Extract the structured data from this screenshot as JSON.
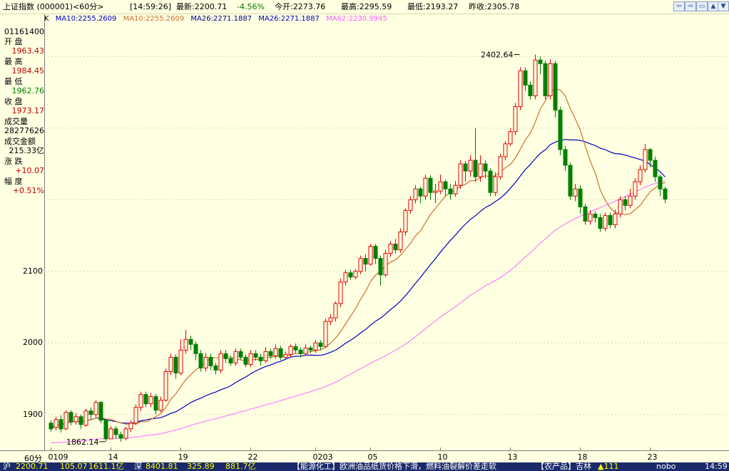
{
  "title_bar": {
    "index_name": "上证指数 (000001)<60分>",
    "time": "[14:59:26]",
    "latest": "最新:2200.71",
    "change_pct": "-4.56%",
    "open": "今开:2273.76",
    "high": "最高:2295.59",
    "low": "最低:2193.27",
    "prev_close": "昨收:2305.78",
    "buttons": [
      "⇦",
      "⇨",
      "▭",
      "▲",
      "▼"
    ]
  },
  "ma_bar": {
    "k_label": "K",
    "ma10_a": "MA10:2255.2609",
    "ma10_b": "MA10:2255.2609",
    "ma26_a": "MA26:2271.1887",
    "ma26_b": "MA26:2271.1887",
    "ma62": "MA62:2230.9945"
  },
  "left_panel": {
    "code": "01161400",
    "rows": [
      {
        "label": "开  盘",
        "value": "1963.43",
        "color": "#c00000"
      },
      {
        "label": "最  高",
        "value": "1984.45",
        "color": "#c00000"
      },
      {
        "label": "最  低",
        "value": "1962.76",
        "color": "#008000"
      },
      {
        "label": "收  盘",
        "value": "1973.17",
        "color": "#c00000"
      },
      {
        "label": "成交量",
        "value": "28277626",
        "color": "#000000"
      },
      {
        "label": "成交金额",
        "value": "215.33亿",
        "color": "#000000"
      },
      {
        "label": "涨  跌",
        "value": "+10.07",
        "color": "#c00000"
      },
      {
        "label": "幅  度",
        "value": "+0.51%",
        "color": "#c00000"
      }
    ]
  },
  "price_axis": [
    {
      "value": 1900,
      "label": "1900"
    },
    {
      "value": 2000,
      "label": "2000"
    },
    {
      "value": 2100,
      "label": "2100"
    }
  ],
  "x_axis": {
    "unit": "60分",
    "ticks": [
      {
        "label": "0109",
        "i": 0
      },
      {
        "label": "14",
        "i": 12
      },
      {
        "label": "19",
        "i": 26
      },
      {
        "label": "22",
        "i": 40
      },
      {
        "label": "0203",
        "i": 53
      },
      {
        "label": "05",
        "i": 64
      },
      {
        "label": "10",
        "i": 78
      },
      {
        "label": "13",
        "i": 92
      },
      {
        "label": "18",
        "i": 106
      },
      {
        "label": "23",
        "i": 120
      }
    ]
  },
  "ticker": {
    "items": [
      "沪",
      "2200.71",
      "105.07",
      "1611.1亿",
      "深",
      "8401.81",
      "325.89",
      "881.7亿",
      "【能源化工】欧洲油品纸货价格下滑，燃料油裂解价差走软",
      "【农产品】吉林",
      "▲111",
      "nobo",
      "14:59"
    ]
  },
  "chart_data": {
    "type": "candlestick",
    "title": "",
    "xlabel": "",
    "ylabel": "",
    "ylim": [
      1850,
      2445
    ],
    "colors": {
      "up": "#e00000",
      "down": "#008000",
      "ma10": "#d07030",
      "ma26": "#0000c0",
      "ma62": "#ff80ff"
    },
    "annotations": [
      {
        "text": "2402.64",
        "i": 94,
        "price": 2402.64
      },
      {
        "text": "1862.14",
        "i": 11,
        "price": 1862.14
      }
    ],
    "candles": [
      [
        1888,
        1880,
        1892,
        1876
      ],
      [
        1882,
        1893,
        1897,
        1878
      ],
      [
        1893,
        1880,
        1899,
        1875
      ],
      [
        1880,
        1903,
        1906,
        1878
      ],
      [
        1903,
        1890,
        1906,
        1885
      ],
      [
        1890,
        1897,
        1902,
        1886
      ],
      [
        1897,
        1886,
        1900,
        1880
      ],
      [
        1885,
        1905,
        1908,
        1883
      ],
      [
        1905,
        1900,
        1910,
        1893
      ],
      [
        1900,
        1917,
        1920,
        1896
      ],
      [
        1917,
        1892,
        1919,
        1888
      ],
      [
        1892,
        1866,
        1894,
        1862.14
      ],
      [
        1866,
        1880,
        1884,
        1866
      ],
      [
        1880,
        1872,
        1884,
        1866
      ],
      [
        1872,
        1867,
        1876,
        1862.14
      ],
      [
        1867,
        1880,
        1883,
        1864
      ],
      [
        1880,
        1888,
        1892,
        1876
      ],
      [
        1888,
        1910,
        1914,
        1885
      ],
      [
        1910,
        1928,
        1932,
        1905
      ],
      [
        1928,
        1915,
        1932,
        1910
      ],
      [
        1915,
        1925,
        1930,
        1910
      ],
      [
        1925,
        1906,
        1929,
        1900
      ],
      [
        1906,
        1920,
        1925,
        1903
      ],
      [
        1920,
        1960,
        1964,
        1918
      ],
      [
        1960,
        1980,
        1985,
        1955
      ],
      [
        1980,
        1958,
        1984,
        1950
      ],
      [
        1958,
        1990,
        2005,
        1955
      ],
      [
        1990,
        2005,
        2018,
        1985
      ],
      [
        2005,
        1998,
        2010,
        1990
      ],
      [
        1998,
        1985,
        2002,
        1976
      ],
      [
        1985,
        1965,
        1990,
        1960
      ],
      [
        1965,
        1980,
        1986,
        1960
      ],
      [
        1980,
        1968,
        1985,
        1962
      ],
      [
        1968,
        1962,
        1972,
        1956
      ],
      [
        1962,
        1985,
        1990,
        1958
      ],
      [
        1985,
        1978,
        1990,
        1972
      ],
      [
        1978,
        1972,
        1982,
        1968
      ],
      [
        1972,
        1988,
        1992,
        1968
      ],
      [
        1988,
        1980,
        1992,
        1976
      ],
      [
        1980,
        1970,
        1984,
        1966
      ],
      [
        1970,
        1985,
        1990,
        1966
      ],
      [
        1985,
        1980,
        1990,
        1975
      ],
      [
        1980,
        1975,
        1985,
        1968
      ],
      [
        1975,
        1988,
        1994,
        1972
      ],
      [
        1988,
        1982,
        1992,
        1978
      ],
      [
        1982,
        1992,
        1998,
        1978
      ],
      [
        1992,
        1980,
        1996,
        1976
      ],
      [
        1980,
        1984,
        1988,
        1978
      ],
      [
        1984,
        1995,
        1998,
        1980
      ],
      [
        1995,
        1990,
        1999,
        1985
      ],
      [
        1990,
        1985,
        1994,
        1980
      ],
      [
        1985,
        1993,
        1998,
        1982
      ],
      [
        1993,
        1990,
        1996,
        1986
      ],
      [
        1990,
        2000,
        2004,
        1986
      ],
      [
        2000,
        1995,
        2004,
        1990
      ],
      [
        1995,
        2030,
        2034,
        1993
      ],
      [
        2030,
        2035,
        2040,
        2025
      ],
      [
        2035,
        2055,
        2058,
        2030
      ],
      [
        2055,
        2085,
        2090,
        2050
      ],
      [
        2085,
        2098,
        2102,
        2080
      ],
      [
        2098,
        2092,
        2102,
        2088
      ],
      [
        2092,
        2100,
        2103,
        2089
      ],
      [
        2100,
        2118,
        2122,
        2096
      ],
      [
        2118,
        2110,
        2124,
        2100
      ],
      [
        2110,
        2135,
        2138,
        2108
      ],
      [
        2135,
        2118,
        2138,
        2110
      ],
      [
        2118,
        2095,
        2122,
        2080
      ],
      [
        2095,
        2125,
        2130,
        2092
      ],
      [
        2125,
        2138,
        2142,
        2120
      ],
      [
        2138,
        2130,
        2145,
        2125
      ],
      [
        2130,
        2155,
        2160,
        2126
      ],
      [
        2155,
        2185,
        2188,
        2150
      ],
      [
        2185,
        2200,
        2205,
        2180
      ],
      [
        2200,
        2215,
        2220,
        2195
      ],
      [
        2215,
        2205,
        2218,
        2195
      ],
      [
        2205,
        2230,
        2235,
        2200
      ],
      [
        2230,
        2210,
        2234,
        2200
      ],
      [
        2210,
        2212,
        2222,
        2195
      ],
      [
        2212,
        2225,
        2235,
        2208
      ],
      [
        2225,
        2215,
        2228,
        2205
      ],
      [
        2215,
        2208,
        2222,
        2200
      ],
      [
        2208,
        2220,
        2226,
        2204
      ],
      [
        2220,
        2250,
        2255,
        2215
      ],
      [
        2250,
        2240,
        2254,
        2225
      ],
      [
        2240,
        2255,
        2262,
        2232
      ],
      [
        2255,
        2232,
        2300,
        2225
      ],
      [
        2232,
        2250,
        2262,
        2225
      ],
      [
        2250,
        2240,
        2255,
        2230
      ],
      [
        2240,
        2210,
        2244,
        2205
      ],
      [
        2210,
        2232,
        2238,
        2205
      ],
      [
        2232,
        2260,
        2264,
        2228
      ],
      [
        2260,
        2278,
        2282,
        2255
      ],
      [
        2278,
        2295,
        2300,
        2275
      ],
      [
        2295,
        2330,
        2335,
        2290
      ],
      [
        2330,
        2380,
        2385,
        2325
      ],
      [
        2380,
        2360,
        2385,
        2352
      ],
      [
        2360,
        2345,
        2365,
        2340
      ],
      [
        2345,
        2395,
        2402.64,
        2340
      ],
      [
        2395,
        2390,
        2400,
        2375
      ],
      [
        2390,
        2345,
        2394,
        2340
      ],
      [
        2345,
        2390,
        2396,
        2340
      ],
      [
        2390,
        2325,
        2394,
        2315
      ],
      [
        2325,
        2270,
        2330,
        2262
      ],
      [
        2270,
        2248,
        2275,
        2240
      ],
      [
        2248,
        2205,
        2252,
        2200
      ],
      [
        2205,
        2215,
        2222,
        2198
      ],
      [
        2215,
        2190,
        2220,
        2180
      ],
      [
        2190,
        2170,
        2194,
        2165
      ],
      [
        2170,
        2180,
        2185,
        2165
      ],
      [
        2180,
        2175,
        2184,
        2168
      ],
      [
        2175,
        2160,
        2180,
        2155
      ],
      [
        2160,
        2178,
        2182,
        2156
      ],
      [
        2178,
        2165,
        2182,
        2160
      ],
      [
        2165,
        2180,
        2186,
        2160
      ],
      [
        2180,
        2200,
        2205,
        2175
      ],
      [
        2200,
        2192,
        2205,
        2185
      ],
      [
        2192,
        2205,
        2215,
        2188
      ],
      [
        2205,
        2225,
        2230,
        2200
      ],
      [
        2225,
        2242,
        2248,
        2220
      ],
      [
        2242,
        2270,
        2278,
        2238
      ],
      [
        2270,
        2255,
        2272,
        2245
      ],
      [
        2255,
        2232,
        2260,
        2225
      ],
      [
        2232,
        2215,
        2235,
        2205
      ],
      [
        2215,
        2200.71,
        2218,
        2195
      ]
    ]
  }
}
